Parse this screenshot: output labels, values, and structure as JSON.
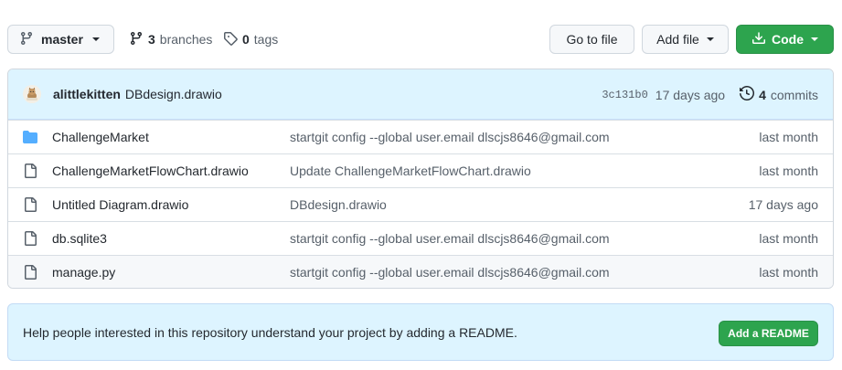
{
  "toolbar": {
    "branch_label": "master",
    "branches_count": "3",
    "branches_label": "branches",
    "tags_count": "0",
    "tags_label": "tags",
    "go_to_file_label": "Go to file",
    "add_file_label": "Add file",
    "code_label": "Code"
  },
  "latest_commit": {
    "author": "alittlekitten",
    "message": "DBdesign.drawio",
    "sha": "3c131b0",
    "time": "17 days ago",
    "commits_count": "4",
    "commits_label": "commits"
  },
  "files": [
    {
      "type": "folder",
      "name": "ChallengeMarket",
      "commit": "startgit config --global user.email dlscjs8646@gmail.com",
      "date": "last month"
    },
    {
      "type": "file",
      "name": "ChallengeMarketFlowChart.drawio",
      "commit": "Update ChallengeMarketFlowChart.drawio",
      "date": "last month"
    },
    {
      "type": "file",
      "name": "Untitled Diagram.drawio",
      "commit": "DBdesign.drawio",
      "date": "17 days ago"
    },
    {
      "type": "file",
      "name": "db.sqlite3",
      "commit": "startgit config --global user.email dlscjs8646@gmail.com",
      "date": "last month"
    },
    {
      "type": "file",
      "name": "manage.py",
      "commit": "startgit config --global user.email dlscjs8646@gmail.com",
      "date": "last month"
    }
  ],
  "readme_banner": {
    "text": "Help people interested in this repository understand your project by adding a README.",
    "button_label": "Add a README"
  },
  "colors": {
    "primary_green": "#2da44e",
    "folder_blue": "#54aeff",
    "banner_blue": "#ddf4ff"
  },
  "icons": {
    "branch": "git-branch-icon",
    "tag": "tag-icon",
    "download": "download-icon",
    "history": "history-icon",
    "folder": "folder-icon",
    "file": "file-icon"
  }
}
